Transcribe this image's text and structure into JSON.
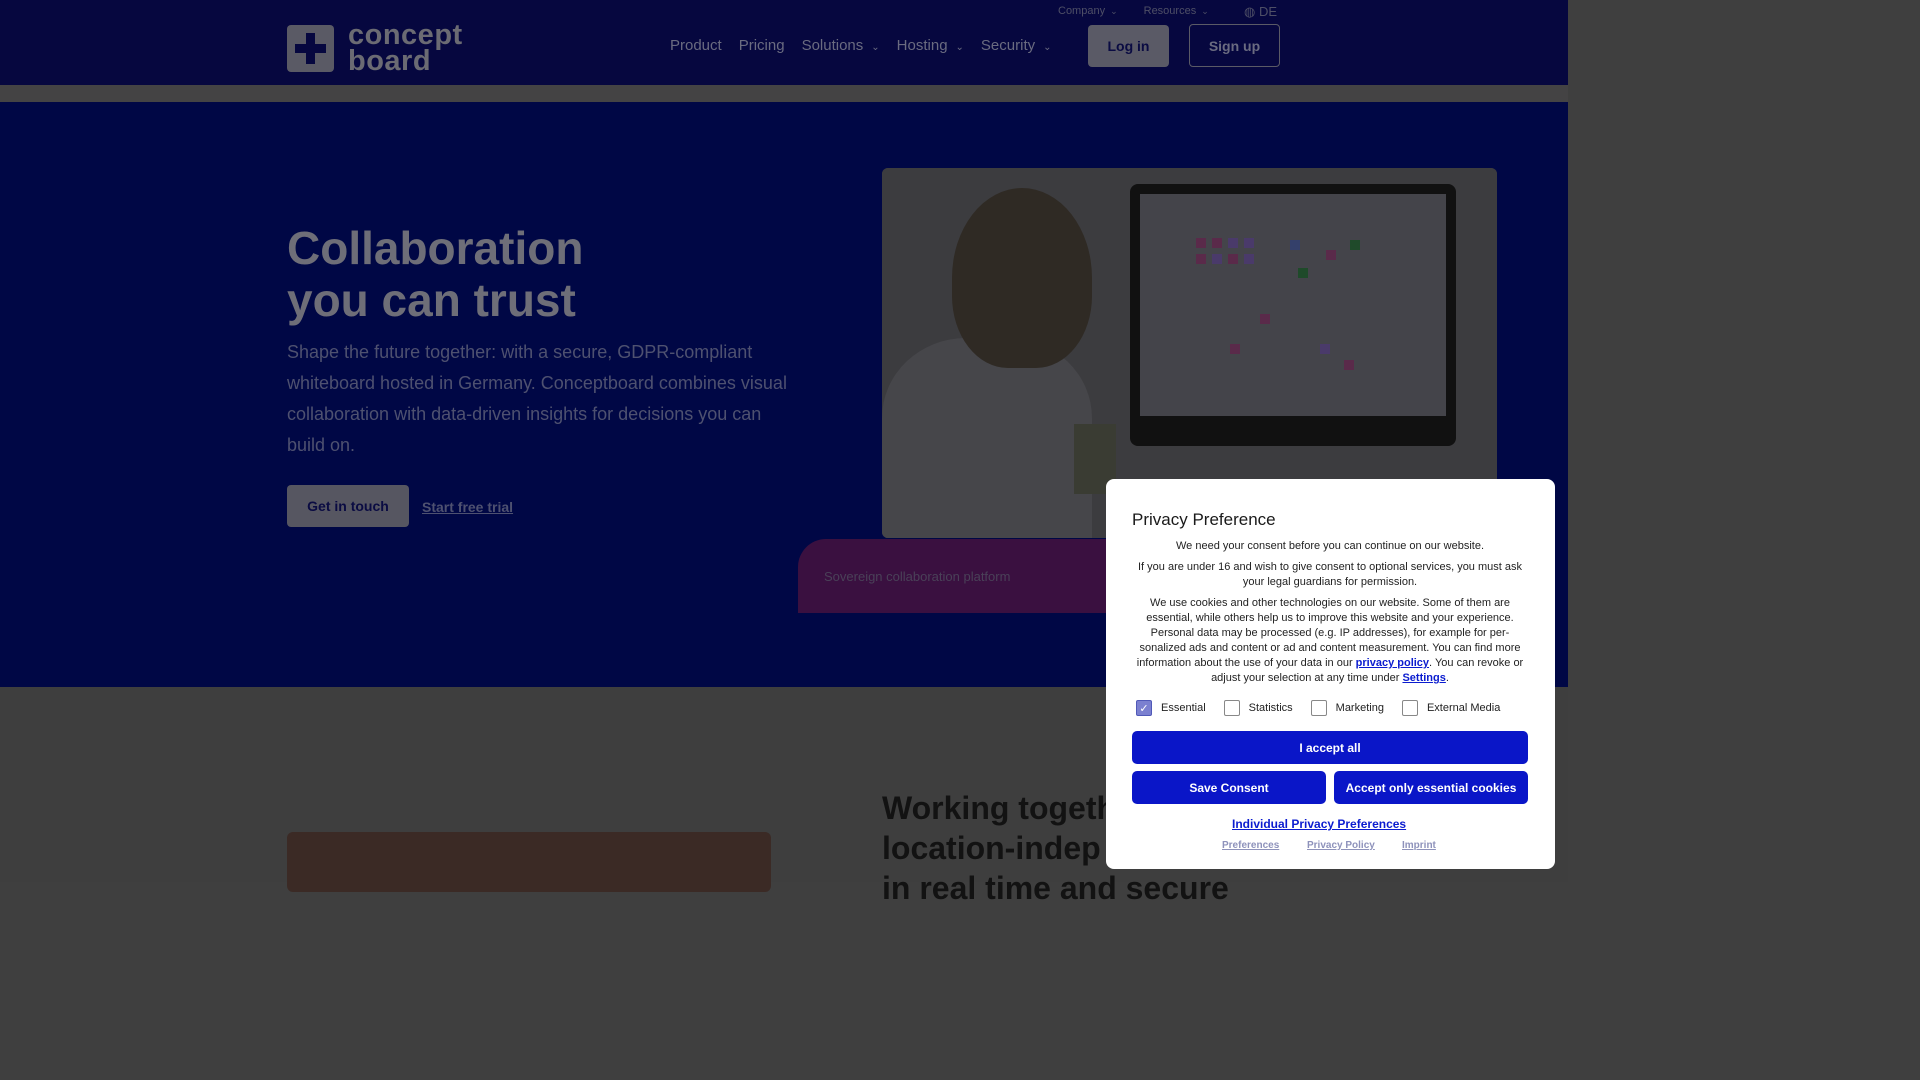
{
  "header": {
    "logo_text_line1": "concept",
    "logo_text_line2": "board",
    "util_nav": [
      "Company",
      "Resources"
    ],
    "language": "DE",
    "nav": {
      "product": "Product",
      "pricing": "Pricing",
      "solutions": "Solutions",
      "hosting": "Hosting",
      "security": "Security"
    },
    "login": "Log in",
    "signup": "Sign up"
  },
  "hero": {
    "title_line1": "Collaboration",
    "title_line2": "you can trust",
    "description": "Shape the future together: with a secure, GDPR-compliant whiteboard hosted in Germany. Conceptboard combines visual collaboration with data-driven insights for decisions you can build on.",
    "cta_primary": "Get in touch",
    "cta_secondary": "Start free trial",
    "badge": "Sovereign collaboration platform"
  },
  "lower": {
    "title_line1": "Working togeth",
    "title_line2": "location-indep",
    "title_line3": "in real time and secure"
  },
  "consent": {
    "title": "Privacy Preference",
    "p1": "We need your consent before you can continue on our website.",
    "p2": "If you are under 16 and wish to give consent to optional services, you must ask your legal guardians for permission.",
    "p3_a": "We use cookies and other technologies on our website. Some of them are essential, while others help us to improve this website and your experience. Personal data may be processed (e.g. IP addresses), for example for per-sonalized ads and content or ad and content measurement. You can find more information about the use of your data in our ",
    "p3_link1": "privacy policy",
    "p3_b": ". You can revoke or adjust your selection at any time under ",
    "p3_link2": "Settings",
    "p3_c": ".",
    "checkboxes": [
      {
        "label": "Essential",
        "checked": true
      },
      {
        "label": "Statistics",
        "checked": false
      },
      {
        "label": "Marketing",
        "checked": false
      },
      {
        "label": "External Media",
        "checked": false
      }
    ],
    "accept_all": "I accept all",
    "save": "Save Consent",
    "accept_essential": "Accept only essential cookies",
    "individual": "Individual Privacy Preferences",
    "footer_links": [
      "Preferences",
      "Privacy Policy",
      "Imprint"
    ]
  },
  "colors": {
    "overlay_navy": "#000745",
    "button_blue": "#0a16c8",
    "link_blue": "#0b1ccf"
  }
}
